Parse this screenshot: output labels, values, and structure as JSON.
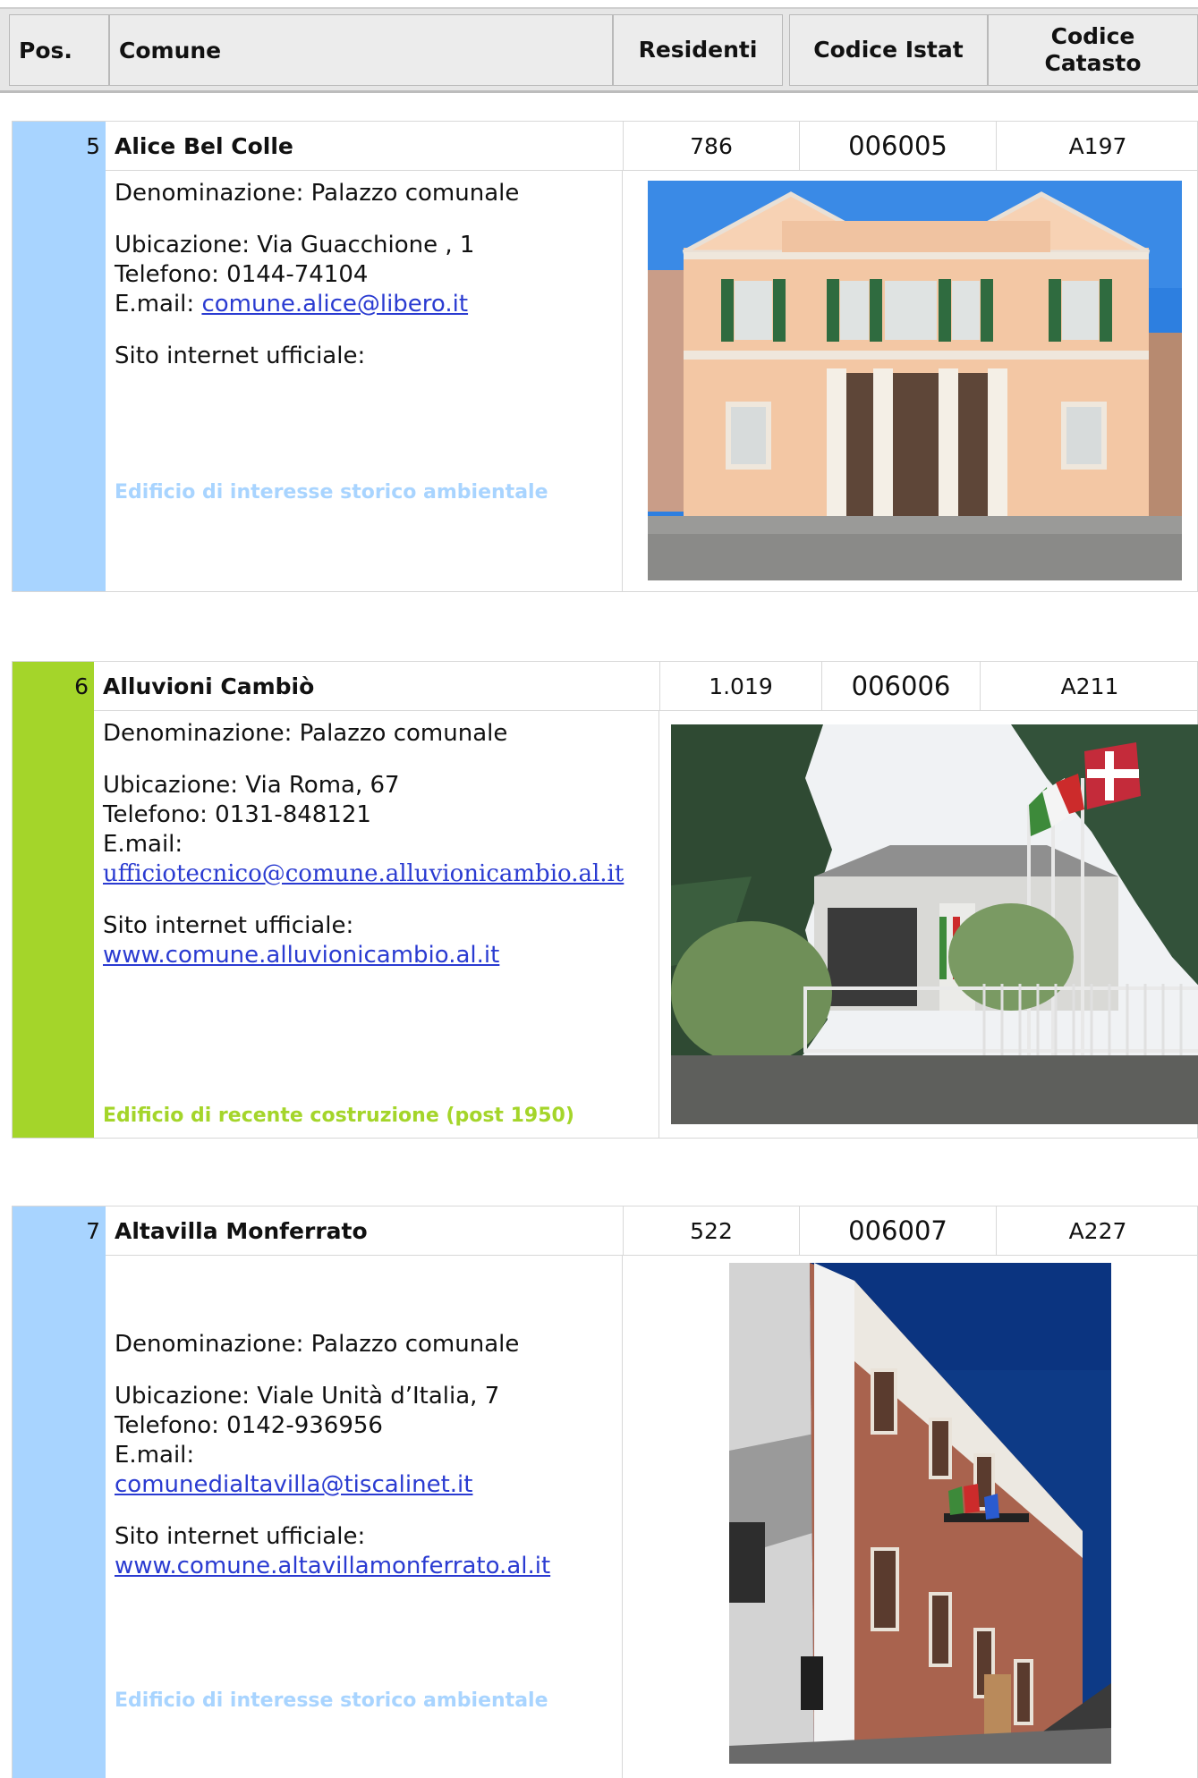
{
  "header": {
    "pos": "Pos.",
    "comune": "Comune",
    "residenti": "Residenti",
    "istat": "Codice Istat",
    "catasto_line1": "Codice",
    "catasto_line2": "Catasto"
  },
  "records": [
    {
      "pos": "5",
      "name": "Alice Bel Colle",
      "residenti": "786",
      "istat": "006005",
      "catasto": "A197",
      "denominazione": "Denominazione: Palazzo comunale",
      "ubicazione": "Ubicazione: Via Guacchione , 1",
      "telefono": "Telefono: 0144-74104",
      "email_label": "E.mail: ",
      "email": "comune.alice@libero.it",
      "sito_label": "Sito internet ufficiale:",
      "sito": "",
      "category": "Edificio di interesse storico ambientale",
      "accent": "#a8d4ff"
    },
    {
      "pos": "6",
      "name": "Alluvioni Cambiò",
      "residenti": "1.019",
      "istat": "006006",
      "catasto": "A211",
      "denominazione": "Denominazione: Palazzo comunale",
      "ubicazione": "Ubicazione: Via Roma, 67",
      "telefono": "Telefono: 0131-848121",
      "email_label": "E.mail:",
      "email": "ufficiotecnico@comune.alluvionicambio.al.it",
      "sito_label": "Sito internet ufficiale:",
      "sito": "www.comune.alluvionicambio.al.it",
      "category": "Edificio di recente costruzione (post 1950)",
      "accent": "#a4d52a"
    },
    {
      "pos": "7",
      "name": "Altavilla Monferrato",
      "residenti": "522",
      "istat": "006007",
      "catasto": "A227",
      "denominazione": "Denominazione: Palazzo comunale",
      "ubicazione": "Ubicazione: Viale Unità d’Italia, 7",
      "telefono": "Telefono: 0142-936956",
      "email_label": "E.mail:",
      "email": "comunedialtavilla@tiscalinet.it",
      "sito_label": "Sito internet ufficiale:",
      "sito": "www.comune.altavillamonferrato.al.it",
      "category": "Edificio di interesse storico ambientale",
      "accent": "#a8d4ff"
    }
  ]
}
